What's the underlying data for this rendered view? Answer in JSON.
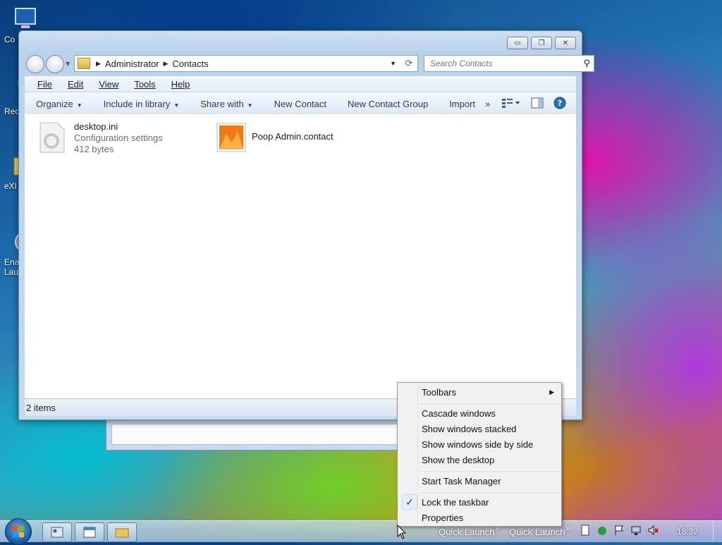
{
  "desktop": {
    "icons": [
      {
        "label": "Co",
        "icon": "computer-icon"
      },
      {
        "label": "Rec",
        "icon": "recycle-bin-icon"
      },
      {
        "label": "eXI",
        "icon": "folder-icon"
      },
      {
        "label": "Enal",
        "label2": "Lau",
        "icon": "disc-icon"
      }
    ]
  },
  "window": {
    "buttons": {
      "minimize": "minimize-icon",
      "maximize": "restore-icon",
      "close": "close-icon"
    },
    "address": {
      "crumbs": [
        "Administrator",
        "Contacts"
      ]
    },
    "search": {
      "placeholder": "Search Contacts"
    },
    "menu": [
      "File",
      "Edit",
      "View",
      "Tools",
      "Help"
    ],
    "commands": [
      "Organize",
      "Include in library",
      "Share with",
      "New Contact",
      "New Contact Group",
      "Import"
    ],
    "files": [
      {
        "name": "desktop.ini",
        "type": "Configuration settings",
        "size": "412 bytes",
        "icon": "settings-file-icon"
      },
      {
        "name": "Poop Admin.contact",
        "icon": "contact-icon"
      }
    ],
    "status": "2 items"
  },
  "context_menu": {
    "items": [
      {
        "label": "Toolbars",
        "submenu": true
      },
      {
        "label": "Cascade windows"
      },
      {
        "label": "Show windows stacked"
      },
      {
        "label": "Show windows side by side"
      },
      {
        "label": "Show the desktop"
      },
      {
        "label": "Start Task Manager"
      },
      {
        "label": "Lock the taskbar",
        "checked": true
      },
      {
        "label": "Properties"
      }
    ]
  },
  "taskbar": {
    "quick_launch": [
      "Quick Launch",
      "Quick Launch"
    ],
    "clock": "18:32"
  },
  "colors": {
    "accent": "#1e3f66",
    "window_frame": "#b9d1ea"
  }
}
